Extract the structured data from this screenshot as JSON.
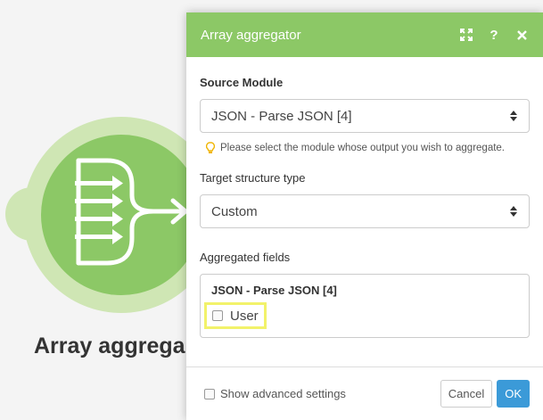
{
  "canvas": {
    "module_title": "Array aggrega",
    "module_icon": "array-aggregator-icon"
  },
  "dialog": {
    "title": "Array aggregator",
    "header_icons": [
      "expand-icon",
      "help-icon",
      "close-icon"
    ],
    "source_module": {
      "label": "Source Module",
      "value": "JSON - Parse JSON [4]",
      "hint": "Please select the module whose output you wish to aggregate."
    },
    "target_structure": {
      "label": "Target structure type",
      "value": "Custom"
    },
    "aggregated_fields": {
      "label": "Aggregated fields",
      "source": "JSON - Parse JSON [4]",
      "items": [
        {
          "label": "User",
          "checked": false
        }
      ]
    },
    "footer": {
      "advanced_label": "Show advanced settings",
      "cancel_label": "Cancel",
      "ok_label": "OK"
    }
  },
  "colors": {
    "accent_green": "#8cc866",
    "ok_blue": "#3b9ad8",
    "highlight_yellow": "#f2f26a"
  }
}
